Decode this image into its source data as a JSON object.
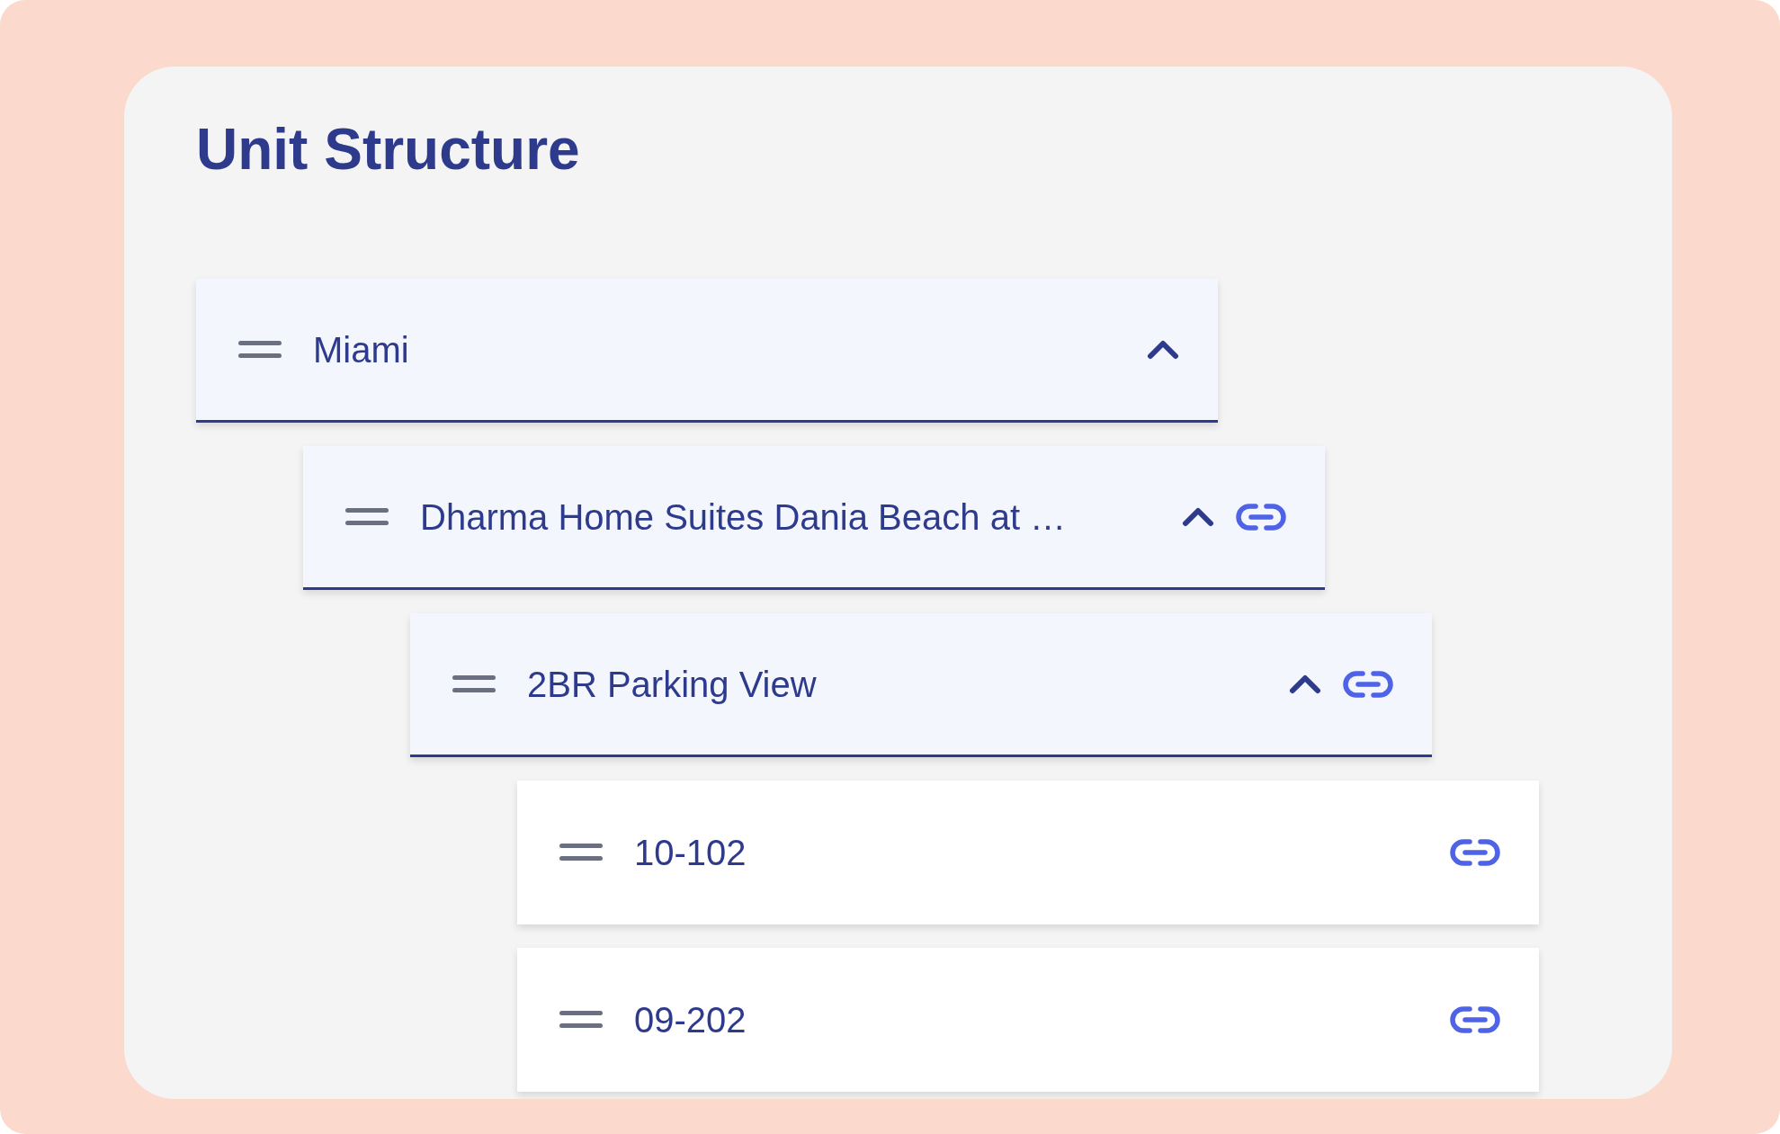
{
  "title": "Unit Structure",
  "tree": [
    {
      "label": "Miami",
      "expanded": true,
      "linked": false,
      "children": [
        {
          "label": "Dharma Home Suites Dania Beach at …",
          "expanded": true,
          "linked": true,
          "children": [
            {
              "label": "2BR Parking View",
              "expanded": true,
              "linked": true,
              "children": [
                {
                  "label": "10-102",
                  "linked": true
                },
                {
                  "label": "09-202",
                  "linked": true
                }
              ]
            }
          ]
        }
      ]
    }
  ]
}
